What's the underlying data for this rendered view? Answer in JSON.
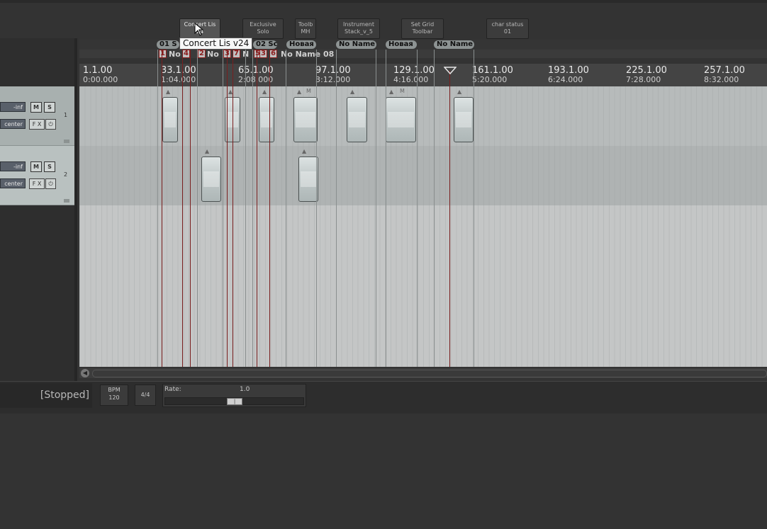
{
  "toolbar": {
    "buttons": [
      {
        "line1": "Concert Lis",
        "line2": "24"
      },
      {
        "line1": "Exclusive",
        "line2": "Solo"
      },
      {
        "line1": "Toolb",
        "line2": "MH"
      },
      {
        "line1": "Instrument",
        "line2": "Stack_v_5"
      },
      {
        "line1": "Set Grid",
        "line2": "Toolbar"
      },
      {
        "line1": "char status",
        "line2": "01"
      }
    ]
  },
  "tooltip": "Concert Lis v24",
  "regions": [
    {
      "label": "01 S"
    },
    {
      "label": "02 Sc"
    },
    {
      "label": "Новая"
    },
    {
      "label": "No Name"
    },
    {
      "label": "Новая"
    },
    {
      "label": "No Name"
    }
  ],
  "markers": {
    "tags": [
      "1",
      "4",
      "2",
      "3",
      "7",
      "5",
      "3",
      "6"
    ],
    "texts": [
      "No",
      "No",
      "N",
      "No Name 08"
    ]
  },
  "ruler": {
    "marks": [
      {
        "bar": "1.1.00",
        "time": "0:00.000"
      },
      {
        "bar": "33.1.00",
        "time": "1:04.000"
      },
      {
        "bar": "65.1.00",
        "time": "2:08.000"
      },
      {
        "bar": "97.1.00",
        "time": "3:12.000"
      },
      {
        "bar": "129.1.00",
        "time": "4:16.000"
      },
      {
        "bar": "161.1.00",
        "time": "5:20.000"
      },
      {
        "bar": "193.1.00",
        "time": "6:24.000"
      },
      {
        "bar": "225.1.00",
        "time": "7:28.000"
      },
      {
        "bar": "257.1.00",
        "time": "8:32.000"
      }
    ]
  },
  "tracks": [
    {
      "number": "1",
      "volume": "-inf",
      "pan": "center",
      "mute": "M",
      "solo": "S",
      "fx": "F X",
      "power": "⏻"
    },
    {
      "number": "2",
      "volume": "-inf",
      "pan": "center",
      "mute": "M",
      "solo": "S",
      "fx": "F X",
      "power": "⏻"
    }
  ],
  "items": {
    "m_label": "M"
  },
  "transport": {
    "status": "[Stopped]",
    "bpm_label": "BPM",
    "bpm_value": "120",
    "time_sig": "4/4",
    "rate_label": "Rate:",
    "rate_value": "1.0",
    "rate_level": 0.5
  },
  "colors": {
    "marker_red": "#8c1d1d",
    "arrange_bg": "#c4c6c6",
    "region_tag": "#8d9393"
  }
}
